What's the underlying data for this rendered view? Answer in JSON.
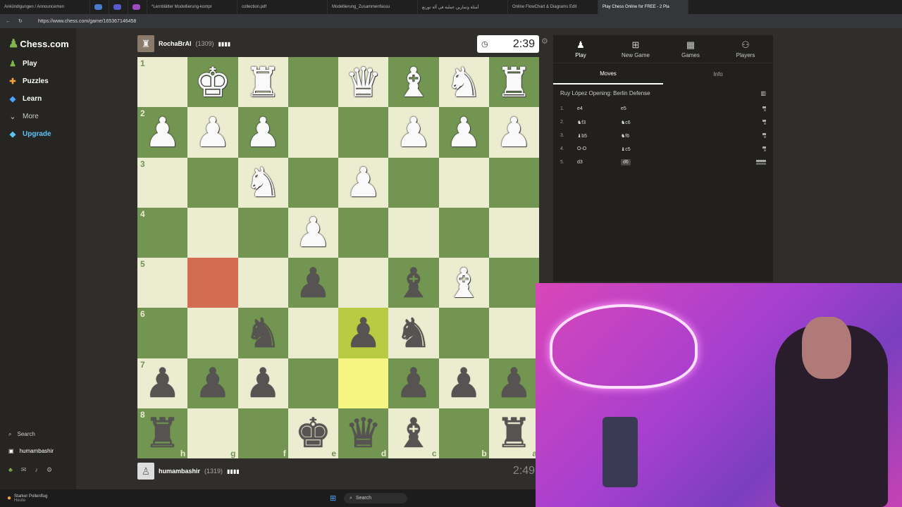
{
  "browser": {
    "tabs": [
      "Ankündigungen / Announcemen",
      "",
      "",
      "",
      "*Lernblätter Modellierung-kompr",
      "collection.pdf",
      "Modellierung_Zusammenfassu",
      "أمثلة وتمارين عملية في آلة تورنغ",
      "Online FlowChart & Diagrams Edit",
      "Play Chess Online for FREE - 2 Pla"
    ],
    "url": "https://www.chess.com/game/165367146458"
  },
  "sidebar": {
    "logo": "Chess.com",
    "items": [
      {
        "label": "Play",
        "icon": "play-icon"
      },
      {
        "label": "Puzzles",
        "icon": "puzzle-icon"
      },
      {
        "label": "Learn",
        "icon": "learn-icon"
      },
      {
        "label": "More",
        "icon": "chevron-down-icon"
      },
      {
        "label": "Upgrade",
        "icon": "diamond-icon"
      }
    ],
    "search_label": "Search",
    "user": "humambashir"
  },
  "top_player": {
    "name": "RochaBrAI",
    "rating": "(1309)",
    "clock": "2:39"
  },
  "bottom_player": {
    "name": "humambashir",
    "rating": "(1319)",
    "clock": "2:49"
  },
  "board": {
    "orientation": "black",
    "ranks": [
      "1",
      "2",
      "3",
      "4",
      "5",
      "6",
      "7",
      "8"
    ],
    "files": [
      "h",
      "g",
      "f",
      "e",
      "d",
      "c",
      "b",
      "a"
    ],
    "rows": [
      [
        "",
        "wK",
        "wR",
        "",
        "wQ",
        "wB",
        "wN",
        "wR"
      ],
      [
        "wP",
        "wP",
        "wP",
        "",
        "",
        "wP",
        "wP",
        "wP"
      ],
      [
        "",
        "",
        "wN",
        "",
        "wP",
        "",
        "",
        ""
      ],
      [
        "",
        "",
        "",
        "wP",
        "",
        "",
        "",
        ""
      ],
      [
        "",
        "",
        "",
        "bP",
        "",
        "bB",
        "wB",
        ""
      ],
      [
        "",
        "",
        "bN",
        "",
        "bP",
        "bN",
        "",
        ""
      ],
      [
        "bP",
        "bP",
        "bP",
        "",
        "",
        "bP",
        "bP",
        "bP"
      ],
      [
        "bR",
        "",
        "",
        "bK",
        "bQ",
        "bB",
        "",
        "bR"
      ]
    ],
    "highlight": [
      [
        5,
        4
      ],
      [
        6,
        4
      ]
    ],
    "marked": [
      4,
      1
    ]
  },
  "panel": {
    "tabs": [
      {
        "label": "Play",
        "icon": "play-icon"
      },
      {
        "label": "New Game",
        "icon": "plus-icon"
      },
      {
        "label": "Games",
        "icon": "games-icon"
      },
      {
        "label": "Players",
        "icon": "players-icon"
      }
    ],
    "subtabs": [
      "Moves",
      "Info"
    ],
    "opening": "Ruy López Opening: Berlin Defense",
    "moves": [
      {
        "num": "1.",
        "white": "e4",
        "black": "e5"
      },
      {
        "num": "2.",
        "white": "♞f3",
        "black": "♞c6"
      },
      {
        "num": "3.",
        "white": "♝b5",
        "black": "♞f6"
      },
      {
        "num": "4.",
        "white": "O-O",
        "black": "♝c5"
      },
      {
        "num": "5.",
        "white": "d3",
        "black": "d6"
      }
    ]
  },
  "taskbar": {
    "weather_title": "Starker Pollenflug",
    "weather_sub": "Heute",
    "search": "Search"
  }
}
